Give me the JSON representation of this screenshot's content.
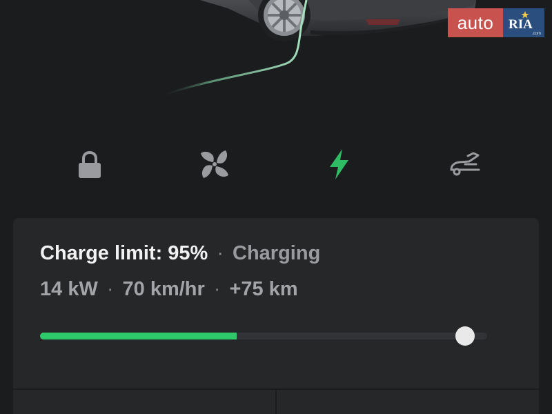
{
  "watermark": {
    "left_text": "auto",
    "right_text": "RIA",
    "right_subtext": ".com"
  },
  "controls": {
    "items": [
      {
        "name": "lock",
        "icon": "lock-icon",
        "color": "#9a9b9e"
      },
      {
        "name": "climate",
        "icon": "fan-icon",
        "color": "#9a9b9e"
      },
      {
        "name": "charge",
        "icon": "bolt-icon",
        "color": "#2ebd64",
        "active": true
      },
      {
        "name": "trunk",
        "icon": "trunk-icon",
        "color": "#9a9b9e"
      }
    ]
  },
  "charging": {
    "limit_text": "Charge limit: 95%",
    "separator": "·",
    "status": "Charging",
    "power": "14 kW",
    "rate": "70 km/hr",
    "range_added": "+75 km",
    "current_level_fraction": 0.44,
    "limit_fraction": 0.95
  },
  "colors": {
    "background": "#1b1c1e",
    "card": "#262729",
    "accent_green": "#2ec96b",
    "text_primary": "#f2f2f2",
    "text_secondary": "#9a9b9e"
  }
}
